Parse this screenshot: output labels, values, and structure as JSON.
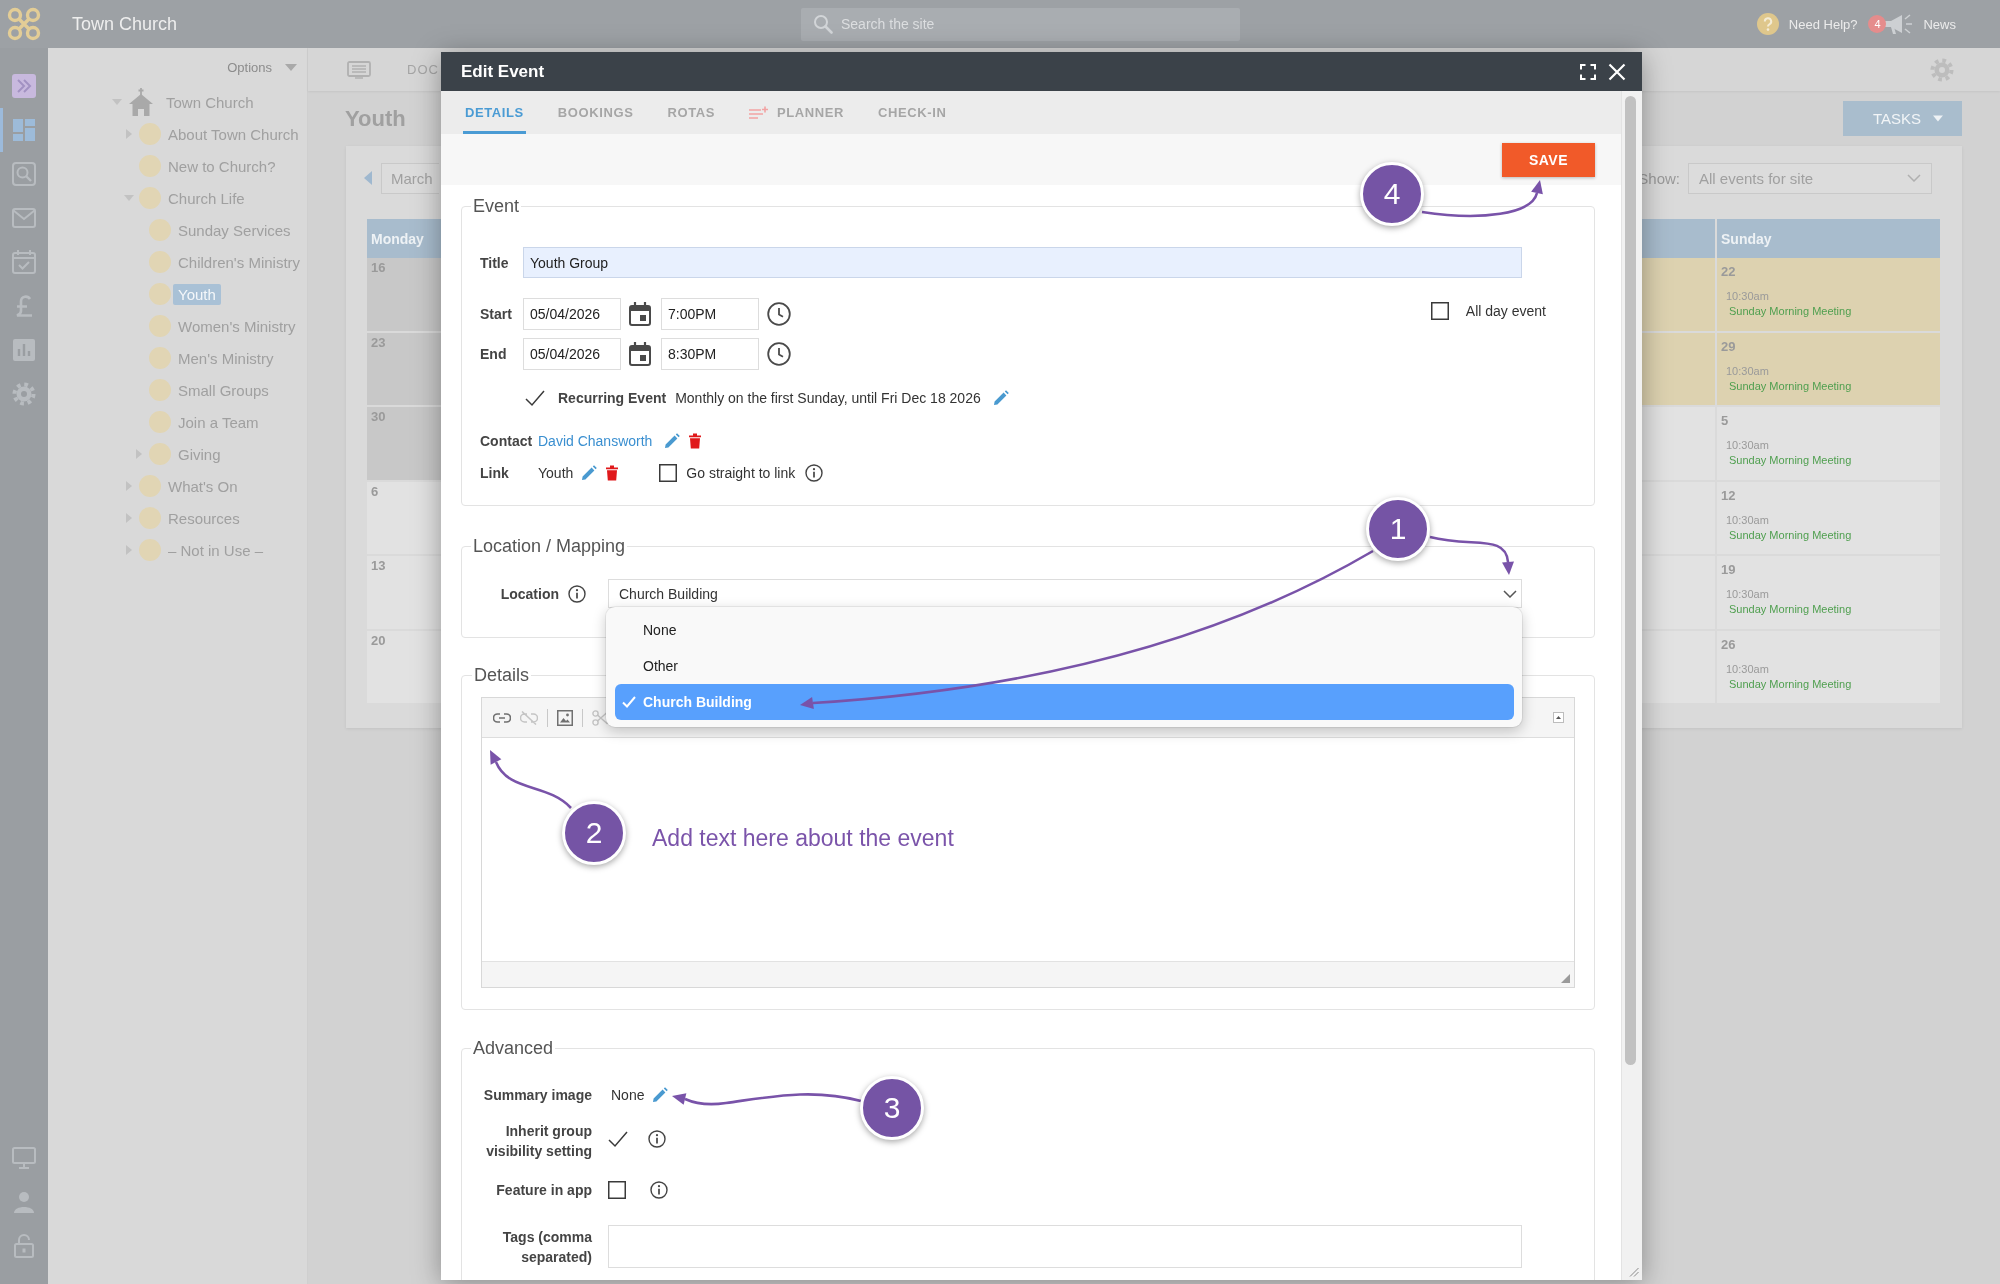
{
  "top_bar": {
    "site_name": "Town Church",
    "search": {
      "placeholder": "Search the site"
    },
    "help_label": "Need Help?",
    "news_count": "4",
    "news_label": "News"
  },
  "nav_rail": {
    "items": [
      {
        "selected": false
      },
      {
        "selected": true
      },
      {
        "selected": false
      },
      {
        "selected": false
      },
      {
        "selected": false
      },
      {
        "selected": false
      },
      {
        "selected": false
      },
      {
        "selected": false
      }
    ]
  },
  "site_tree": {
    "options_label": "Options",
    "items": [
      {
        "label": "Town Church",
        "kind": "site",
        "expanded": true,
        "selected": false,
        "children": [
          {
            "label": "About Town Church",
            "kind": "page",
            "expanded": false,
            "selected": false
          },
          {
            "label": "New to Church?",
            "kind": "page",
            "selected": false
          },
          {
            "label": "Church Life",
            "kind": "page",
            "expanded": true,
            "selected": false,
            "children": [
              {
                "label": "Sunday Services",
                "kind": "page",
                "selected": false
              },
              {
                "label": "Children's Ministry",
                "kind": "page",
                "selected": false
              },
              {
                "label": "Youth",
                "kind": "page",
                "selected": true
              },
              {
                "label": "Women's Ministry",
                "kind": "page",
                "selected": false
              },
              {
                "label": "Men's Ministry",
                "kind": "page",
                "selected": false
              },
              {
                "label": "Small Groups",
                "kind": "page",
                "selected": false
              },
              {
                "label": "Join a Team",
                "kind": "page",
                "selected": false
              },
              {
                "label": "Giving",
                "kind": "page",
                "expanded": false,
                "selected": false
              }
            ]
          },
          {
            "label": "What's On",
            "kind": "page",
            "expanded": false,
            "selected": false
          },
          {
            "label": "Resources",
            "kind": "page",
            "expanded": false,
            "selected": false
          },
          {
            "label": "– Not in Use –",
            "kind": "page",
            "expanded": false,
            "selected": false
          }
        ]
      }
    ]
  },
  "page": {
    "toolbar_label": "DOC",
    "heading": "Youth",
    "tasks_button": "TASKS"
  },
  "calendar": {
    "month": "March",
    "show_label": "Show:",
    "show_value": "All events for site",
    "columns": [
      {
        "label": "Monday"
      },
      {
        "label": "Sunday"
      }
    ],
    "weeks": [
      {
        "monday": {
          "date": "16",
          "current_month": true
        },
        "saturday": {
          "current_month": true
        },
        "sunday": {
          "date": "22",
          "current_month": true,
          "events": [
            {
              "time": "10:30am",
              "title": "Sunday Morning Meeting"
            }
          ]
        }
      },
      {
        "monday": {
          "date": "23",
          "current_month": true
        },
        "saturday": {
          "current_month": true
        },
        "sunday": {
          "date": "29",
          "current_month": true,
          "events": [
            {
              "time": "10:30am",
              "title": "Sunday Morning Meeting"
            }
          ]
        }
      },
      {
        "monday": {
          "date": "30",
          "current_month": true
        },
        "saturday": {
          "current_month": false
        },
        "sunday": {
          "date": "5",
          "current_month": false,
          "events": [
            {
              "time": "10:30am",
              "title": "Sunday Morning Meeting"
            }
          ]
        }
      },
      {
        "monday": {
          "date": "6",
          "current_month": false
        },
        "saturday": {
          "current_month": false
        },
        "sunday": {
          "date": "12",
          "current_month": false,
          "events": [
            {
              "time": "10:30am",
              "title": "Sunday Morning Meeting"
            }
          ]
        }
      },
      {
        "monday": {
          "date": "13",
          "current_month": false
        },
        "saturday": {
          "current_month": false
        },
        "sunday": {
          "date": "19",
          "current_month": false,
          "events": [
            {
              "time": "10:30am",
              "title": "Sunday Morning Meeting"
            }
          ]
        }
      },
      {
        "monday": {
          "date": "20",
          "current_month": false
        },
        "saturday": {
          "current_month": false
        },
        "sunday": {
          "date": "26",
          "current_month": false,
          "events": [
            {
              "time": "10:30am",
              "title": "Sunday Morning Meeting"
            }
          ]
        }
      }
    ]
  },
  "modal": {
    "title": "Edit Event",
    "tabs": [
      {
        "label": "DETAILS",
        "kind": "text",
        "selected": true
      },
      {
        "label": "BOOKINGS",
        "kind": "text",
        "selected": false
      },
      {
        "label": "ROTAS",
        "kind": "text",
        "selected": false
      },
      {
        "label": "PLANNER",
        "kind": "icon",
        "selected": false
      },
      {
        "label": "CHECK-IN",
        "kind": "text",
        "selected": false
      }
    ],
    "save_button": "SAVE",
    "event": {
      "legend": "Event",
      "title": {
        "label": "Title",
        "value": "Youth Group"
      },
      "start": {
        "label": "Start",
        "date": "05/04/2026",
        "time": "7:00PM"
      },
      "end": {
        "label": "End",
        "date": "05/04/2026",
        "time": "8:30PM"
      },
      "all_day": {
        "label": "All day event",
        "checked": false
      },
      "recurring": {
        "label": "Recurring Event",
        "checked": true,
        "summary": "Monthly on the first Sunday, until Fri Dec 18 2026"
      },
      "contact": {
        "label": "Contact",
        "value": "David Chansworth"
      },
      "link": {
        "label": "Link",
        "value": "Youth",
        "go_straight": {
          "label": "Go straight to link",
          "checked": false
        }
      }
    },
    "location": {
      "legend": "Location / Mapping",
      "label": "Location",
      "value": "Church Building",
      "expanded": true,
      "options": [
        {
          "label": "None",
          "selected": false
        },
        {
          "label": "Other",
          "selected": false
        },
        {
          "label": "Church Building",
          "selected": true
        }
      ]
    },
    "details": {
      "legend": "Details"
    },
    "advanced": {
      "legend": "Advanced",
      "summary_image": {
        "label": "Summary image",
        "value": "None"
      },
      "inherit_visibility": {
        "label": "Inherit group visibility setting",
        "checked": true
      },
      "feature_in_app": {
        "label": "Feature in app",
        "checked": false
      },
      "tags": {
        "label": "Tags (comma separated)"
      }
    }
  },
  "callouts": [
    {
      "number": "1"
    },
    {
      "number": "2",
      "note": "Add text here about the event"
    },
    {
      "number": "3"
    },
    {
      "number": "4"
    }
  ]
}
